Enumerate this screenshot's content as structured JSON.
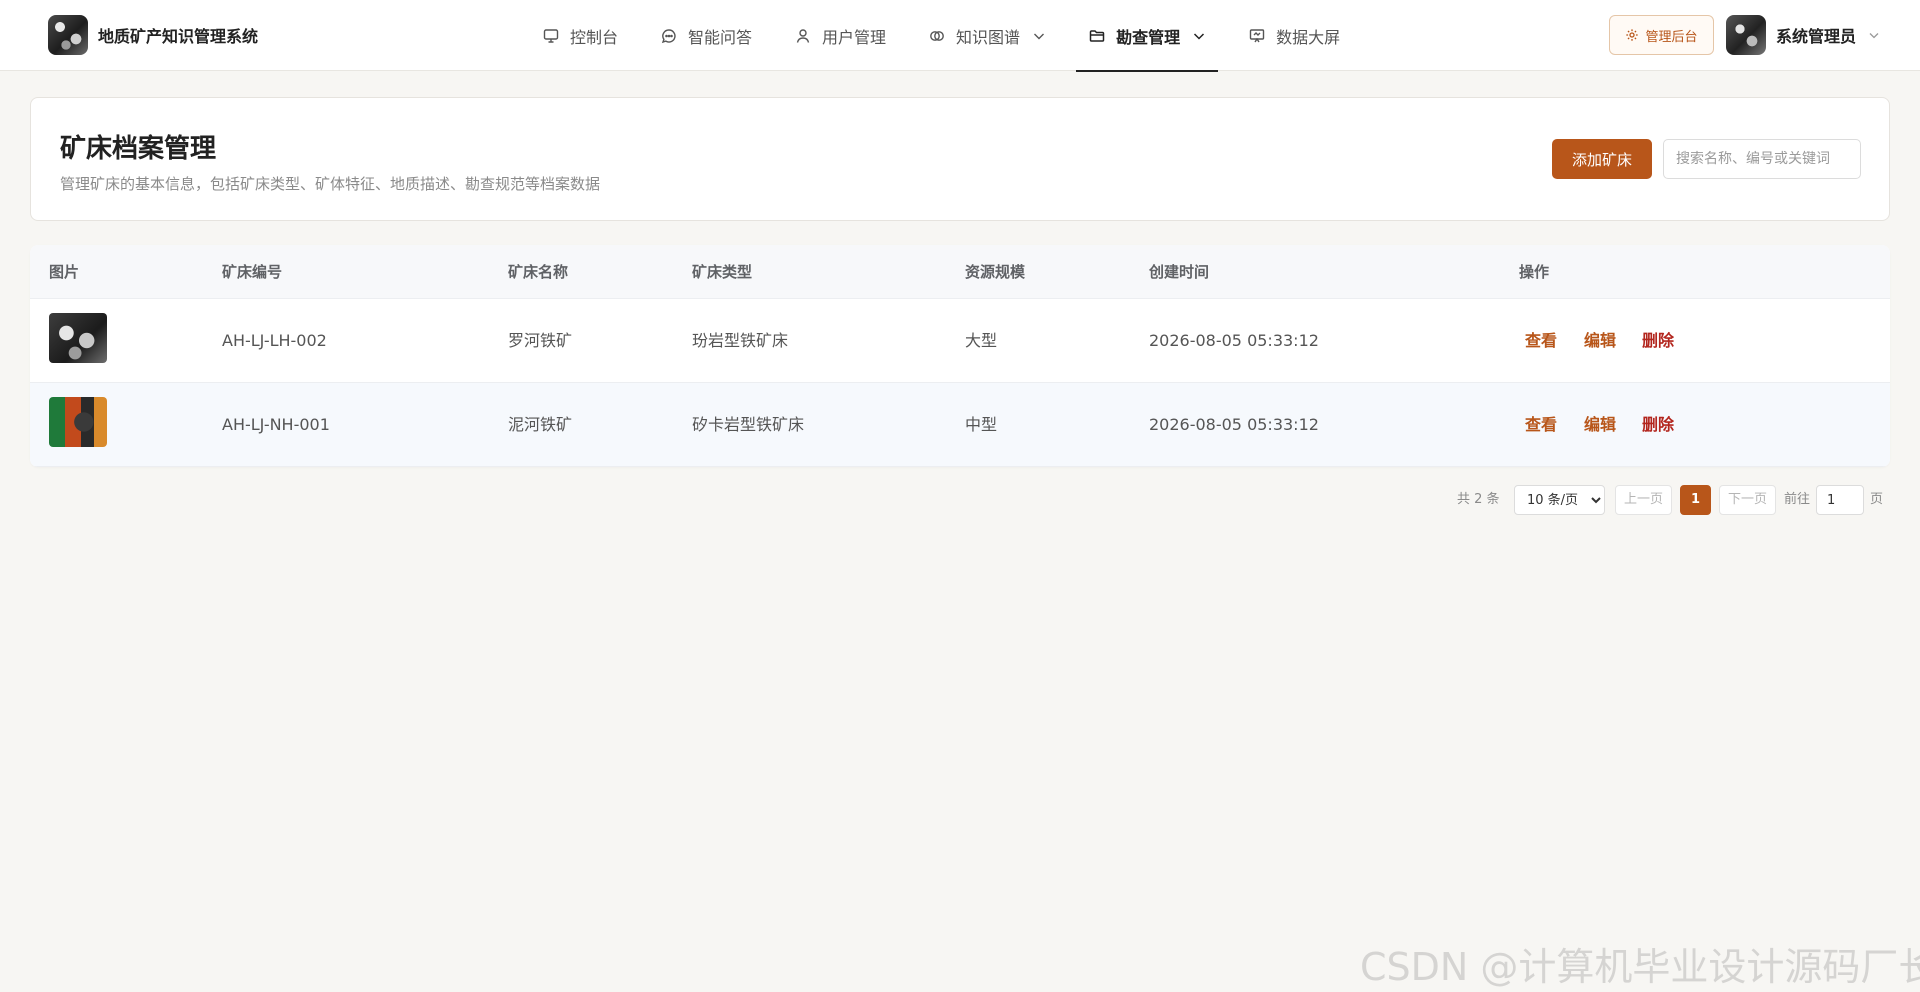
{
  "brand": {
    "name": "地质矿产知识管理系统"
  },
  "nav": {
    "items": [
      {
        "label": "控制台",
        "icon": "monitor-icon"
      },
      {
        "label": "智能问答",
        "icon": "chat-icon"
      },
      {
        "label": "用户管理",
        "icon": "user-icon"
      },
      {
        "label": "知识图谱",
        "icon": "graph-icon",
        "has_dropdown": true
      },
      {
        "label": "勘查管理",
        "icon": "folder-icon",
        "has_dropdown": true,
        "active": true
      },
      {
        "label": "数据大屏",
        "icon": "dashboard-icon"
      }
    ]
  },
  "header": {
    "admin_label": "管理后台",
    "user_name": "系统管理员"
  },
  "page": {
    "title": "矿床档案管理",
    "subtitle": "管理矿床的基本信息，包括矿床类型、矿体特征、地质描述、勘查规范等档案数据",
    "add_button": "添加矿床",
    "search_placeholder": "搜索名称、编号或关键词"
  },
  "table": {
    "columns": [
      "图片",
      "矿床编号",
      "矿床名称",
      "矿床类型",
      "资源规模",
      "创建时间",
      "操作"
    ],
    "rows": [
      {
        "code": "AH-LJ-LH-002",
        "name": "罗河铁矿",
        "type": "玢岩型铁矿床",
        "scale": "大型",
        "created": "2026-08-05 05:33:12"
      },
      {
        "code": "AH-LJ-NH-001",
        "name": "泥河铁矿",
        "type": "矽卡岩型铁矿床",
        "scale": "中型",
        "created": "2026-08-05 05:33:12"
      }
    ],
    "actions": {
      "view": "查看",
      "edit": "编辑",
      "delete": "删除"
    }
  },
  "pagination": {
    "total": "共 2 条",
    "page_size": "10 条/页",
    "prev": "上一页",
    "current": "1",
    "next": "下一页",
    "goto": "前往",
    "goto_value": "1",
    "page_suffix": "页"
  },
  "watermark": "CSDN @计算机毕业设计源码厂长",
  "colors": {
    "accent": "#b8561a",
    "danger": "#b3261e",
    "background": "#f7f6f3"
  }
}
